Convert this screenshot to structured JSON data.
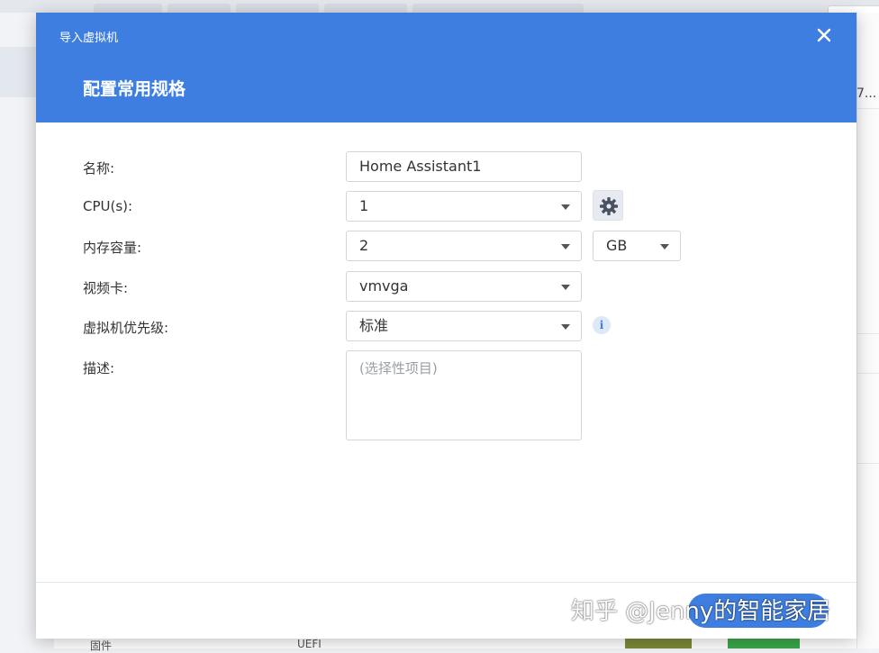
{
  "dialog": {
    "window_title": "导入虚拟机",
    "step_title": "配置常用规格",
    "close_icon": "close-icon"
  },
  "form": {
    "name_label": "名称:",
    "name_value": "Home Assistant1",
    "cpu_label": "CPU(s):",
    "cpu_value": "1",
    "cpu_settings_icon": "gear-icon",
    "memory_label": "内存容量:",
    "memory_value": "2",
    "memory_unit": "GB",
    "video_label": "视频卡:",
    "video_value": "vmvga",
    "priority_label": "虚拟机优先级:",
    "priority_value": "标准",
    "priority_info_icon": "info-icon",
    "priority_info_glyph": "i",
    "description_label": "描述:",
    "description_placeholder": "(选择性项目)"
  },
  "background": {
    "right_cell_text": "7...",
    "bottom_left_text": "固件",
    "bottom_mid_text": "UEFI"
  },
  "watermark": "知乎 @Jenny的智能家居",
  "colors": {
    "accent": "#3d7ee0",
    "header_text": "#ffffff"
  }
}
